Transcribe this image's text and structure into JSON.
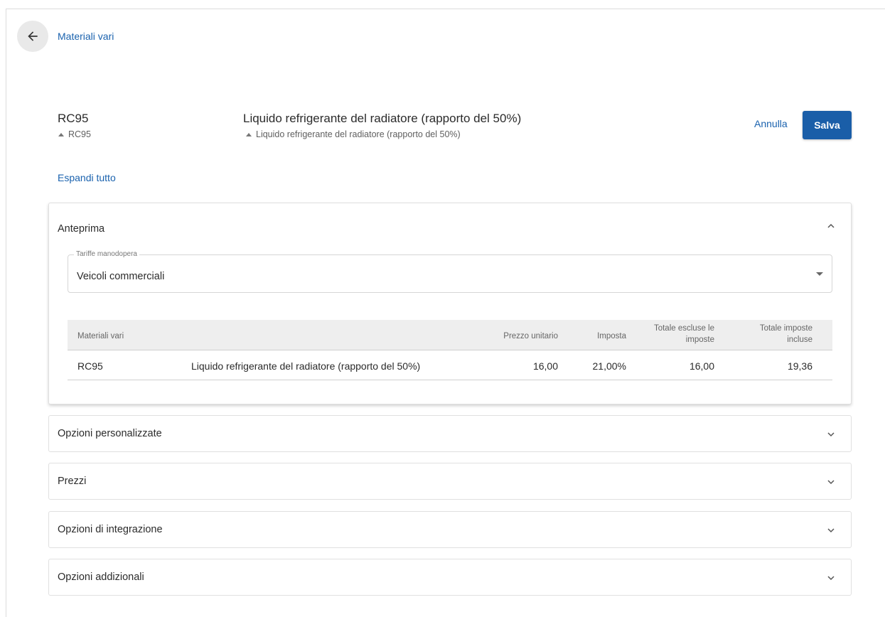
{
  "nav": {
    "breadcrumb": "Materiali vari"
  },
  "header": {
    "code": "RC95",
    "code_secondary": "RC95",
    "description": "Liquido refrigerante del radiatore (rapporto del 50%)",
    "description_secondary": "Liquido refrigerante del radiatore (rapporto del 50%)",
    "cancel_label": "Annulla",
    "save_label": "Salva"
  },
  "expand_all_label": "Espandi tutto",
  "preview": {
    "title": "Anteprima",
    "rates_field": {
      "label": "Tariffe manodopera",
      "value": "Veicoli commerciali"
    },
    "table": {
      "headers": {
        "item": "Materiali vari",
        "unit_price": "Prezzo unitario",
        "tax": "Imposta",
        "total_excl_1": "Totale escluse le",
        "total_excl_2": "imposte",
        "total_incl_1": "Totale imposte",
        "total_incl_2": "incluse"
      },
      "rows": [
        {
          "code": "RC95",
          "description": "Liquido refrigerante del radiatore (rapporto del 50%)",
          "unit_price": "16,00",
          "tax": "21,00%",
          "total_excl": "16,00",
          "total_incl": "19,36"
        }
      ]
    }
  },
  "sections": [
    {
      "title": "Opzioni personalizzate"
    },
    {
      "title": "Prezzi"
    },
    {
      "title": "Opzioni di integrazione"
    },
    {
      "title": "Opzioni addizionali"
    }
  ],
  "icons": {
    "back": "arrow-left-icon",
    "collapse": "chevron-up-icon",
    "expand": "chevron-down-icon",
    "select": "caret-down-icon",
    "sort": "triangle-up-icon"
  },
  "colors": {
    "primary": "#1a5ea8",
    "link": "#1a62ae"
  }
}
